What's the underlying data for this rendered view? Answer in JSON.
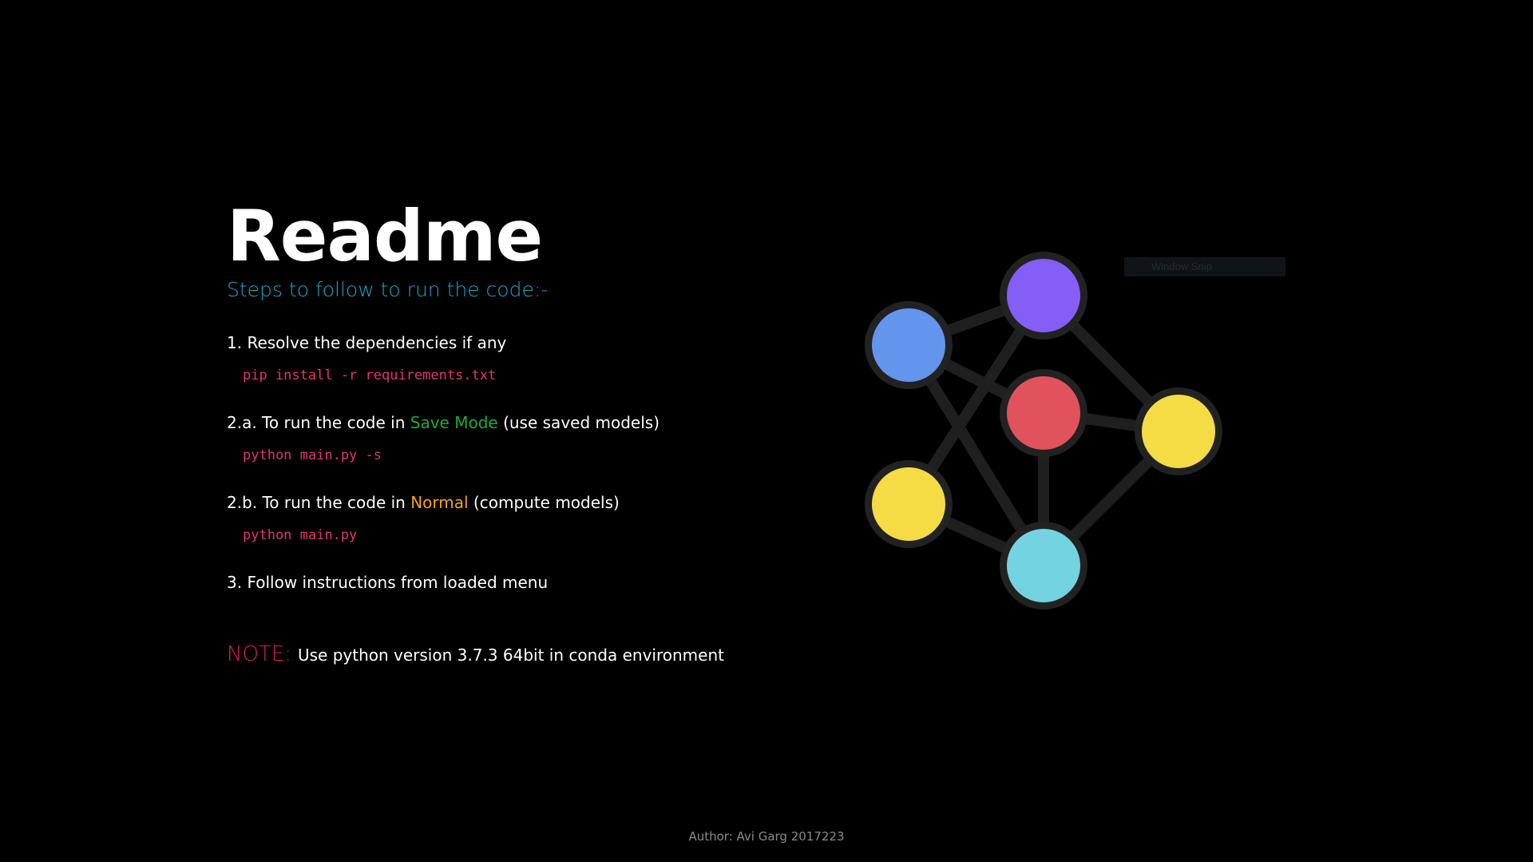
{
  "readme": {
    "title": "Readme",
    "subtitle": "Steps to follow to run the code:-",
    "steps": [
      {
        "label": "1. Resolve the dependencies if any",
        "command": "pip install -r requirements.txt"
      },
      {
        "label_prefix": "2.a. To run the code in ",
        "label_highlight": "Save Mode",
        "label_suffix": " (use saved models)",
        "highlight_color": "#1faa3b",
        "command": "python main.py -s"
      },
      {
        "label_prefix": "2.b. To run the code in ",
        "label_highlight": "Normal",
        "label_suffix": " (compute models)",
        "highlight_color": "#f3a31c",
        "command": "python main.py"
      },
      {
        "label": "3. Follow instructions from loaded menu"
      }
    ],
    "note": {
      "label": "NOTE:",
      "text": "Use python version 3.7.3 64bit in conda environment"
    }
  },
  "footer": {
    "author": "Author: Avi Garg 2017223"
  },
  "overlay": {
    "snip_label": "Window Snip"
  },
  "graph": {
    "edge_color": "#1f1f1f",
    "node_ring_color": "#222222",
    "nodes": [
      {
        "name": "node-blue",
        "color": "#6495ed"
      },
      {
        "name": "node-purple",
        "color": "#845ef7"
      },
      {
        "name": "node-red",
        "color": "#e0525c"
      },
      {
        "name": "node-yellow-right",
        "color": "#f5dc45"
      },
      {
        "name": "node-yellow-left",
        "color": "#f5dc45"
      },
      {
        "name": "node-cyan",
        "color": "#74d3e0"
      }
    ]
  }
}
